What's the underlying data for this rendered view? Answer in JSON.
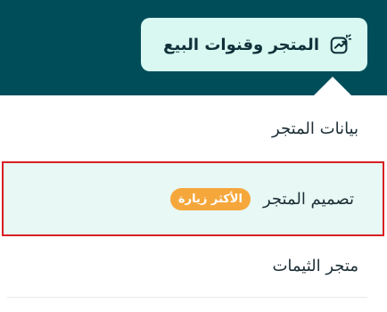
{
  "header": {
    "store_menu_label": "المتجر وقنوات البيع",
    "store_menu_icon": "store-trend-icon"
  },
  "menu": {
    "items": [
      {
        "label": "بيانات المتجر",
        "highlighted": false
      },
      {
        "label": "تصميم المتجر",
        "highlighted": true,
        "badge": "الأكثر زيارة"
      },
      {
        "label": "متجر الثيمات",
        "highlighted": false
      }
    ]
  },
  "colors": {
    "header_background": "#004d5a",
    "store_button_background": "#d8f8f1",
    "highlight_background": "#e8f8f4",
    "highlight_border": "#d81f24",
    "badge_background": "#f6a73b"
  }
}
